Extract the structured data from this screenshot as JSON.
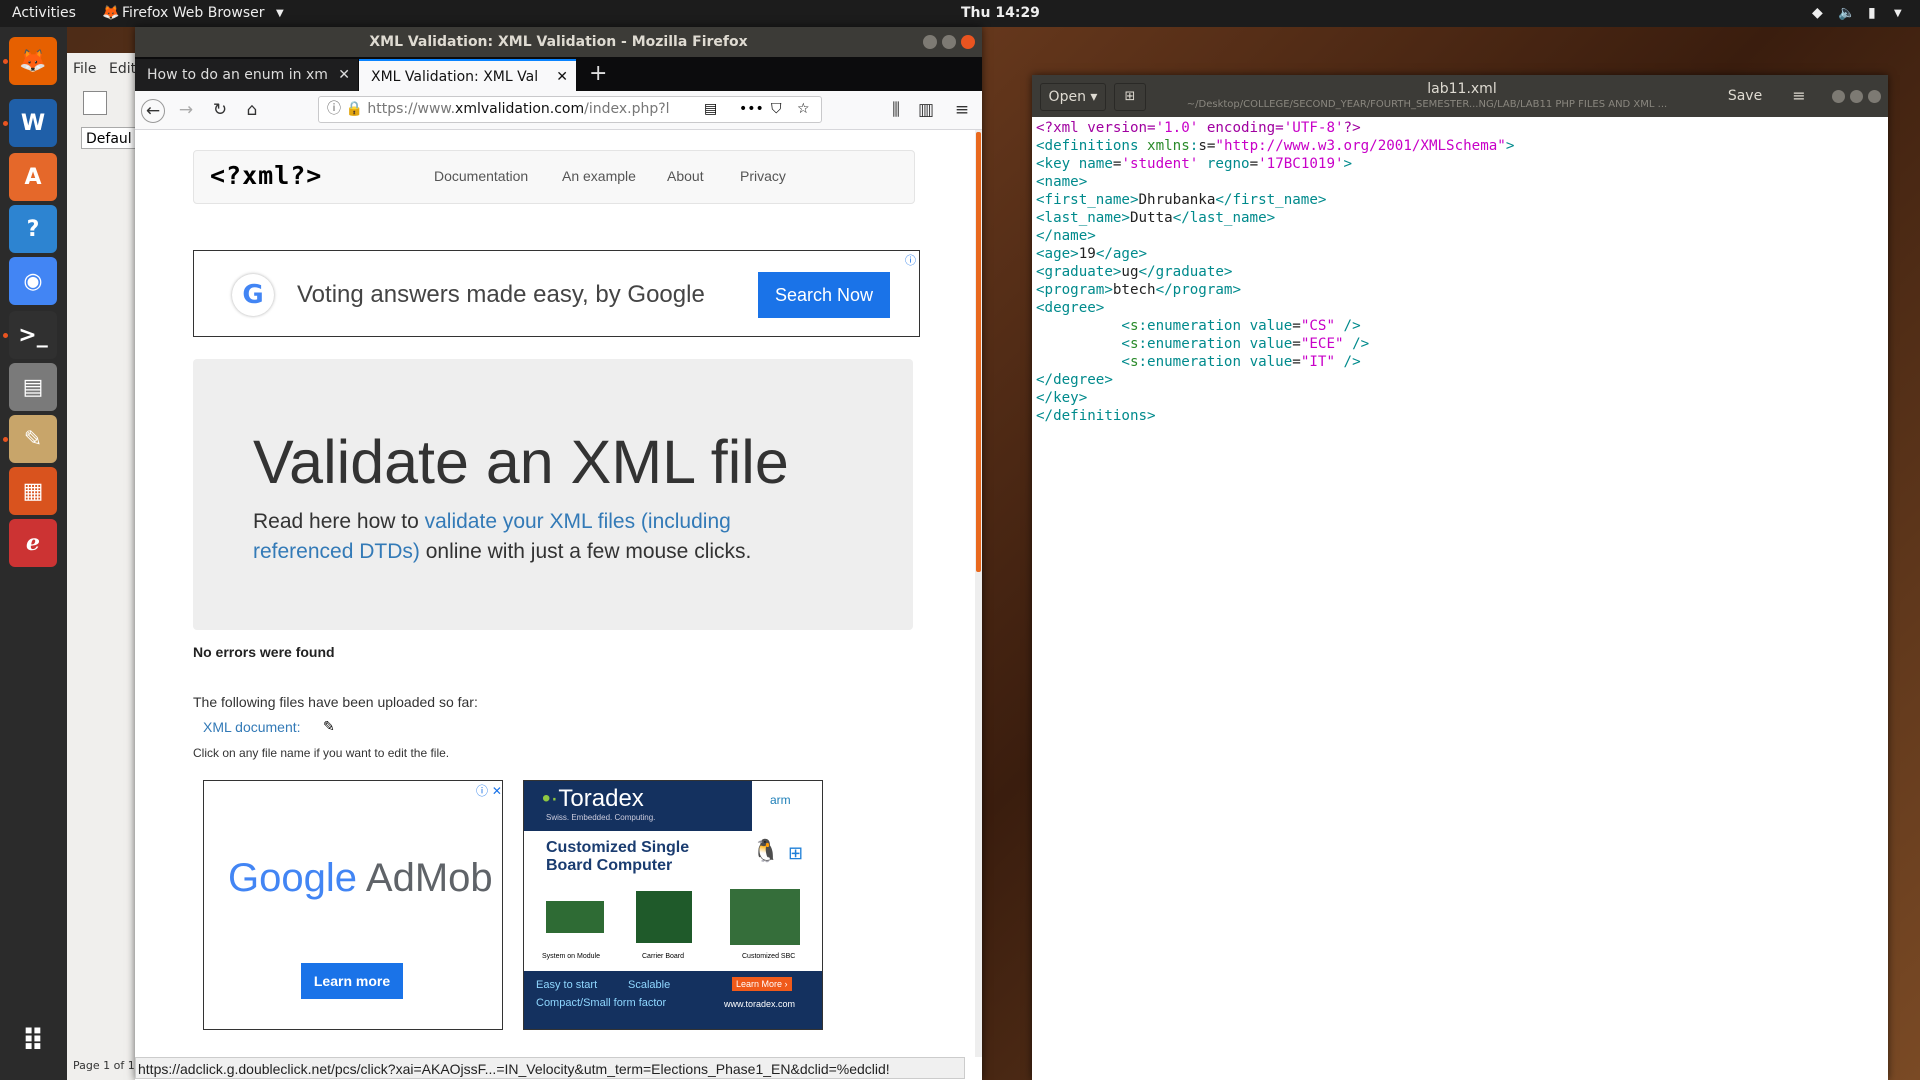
{
  "topbar": {
    "activities": "Activities",
    "app_name": "Firefox Web Browser",
    "clock": "Thu 14:29"
  },
  "dock": {
    "items": [
      {
        "name": "firefox",
        "glyph": "🦊",
        "color": "#e66000"
      },
      {
        "name": "writer",
        "glyph": "W",
        "color": "#1f5fa8"
      },
      {
        "name": "software",
        "glyph": "A",
        "color": "#e5682a"
      },
      {
        "name": "help",
        "glyph": "?",
        "color": "#2d84d1"
      },
      {
        "name": "chrome",
        "glyph": "◉",
        "color": "#4285f4"
      },
      {
        "name": "terminal",
        "glyph": ">_",
        "color": "#303030"
      },
      {
        "name": "files",
        "glyph": "▤",
        "color": "#7a7a7a"
      },
      {
        "name": "text-editor",
        "glyph": "✎",
        "color": "#c8a56a"
      },
      {
        "name": "impress",
        "glyph": "▦",
        "color": "#d9531e"
      },
      {
        "name": "evince",
        "glyph": "ℯ",
        "color": "#c33"
      }
    ],
    "show_apps": "⠿"
  },
  "libreoffice": {
    "menu_file": "File",
    "menu_edit": "Edit",
    "style_box": "Defaul",
    "status": "Page 1 of 1"
  },
  "firefox": {
    "window_title": "XML Validation: XML Validation - Mozilla Firefox",
    "tabs": [
      {
        "label": "How to do an enum in xm"
      },
      {
        "label": "XML Validation: XML Val"
      }
    ],
    "url_prefix": "https://www.",
    "url_domain": "xmlvalidation.com",
    "url_path": "/index.php?l",
    "status_url": "https://adclick.g.doubleclick.net/pcs/click?xai=AKAOjssF...=IN_Velocity&utm_term=Elections_Phase1_EN&dclid=%edclid!"
  },
  "page": {
    "logo": "<?xml?>",
    "nav": [
      "Documentation",
      "An example",
      "About",
      "Privacy"
    ],
    "ad_text": "Voting answers made easy, by Google",
    "ad_button": "Search Now",
    "hero_title": "Validate an XML file",
    "hero_text_before": "Read here how to ",
    "hero_link": "validate your XML files (including referenced DTDs)",
    "hero_text_after": " online with just a few mouse clicks.",
    "result": "No errors were found",
    "uploaded_label": "The following files have been uploaded so far:",
    "file_link": "XML document:",
    "edit_hint": "Click on any file name if you want to edit the file.",
    "admob_google": "Google",
    "admob_text": "AdMob",
    "admob_button": "Learn more",
    "toradex": {
      "brand": "Toradex",
      "tagline": "Swiss. Embedded. Computing.",
      "arm": "arm",
      "headline": "Customized Single Board Computer",
      "labels": [
        "System on Module",
        "Carrier Board",
        "Customized SBC"
      ],
      "bullet1": "Easy to start",
      "bullet2": "Scalable",
      "bullet3": "Compact/Small form factor",
      "learn_more": "Learn More ›",
      "site": "www.toradex.com"
    }
  },
  "gedit": {
    "open_label": "Open",
    "filename": "lab11.xml",
    "path": "~/Desktop/COLLEGE/SECOND_YEAR/FOURTH_SEMESTER...NG/LAB/LAB11 PHP FILES AND XML ...",
    "save_label": "Save"
  }
}
